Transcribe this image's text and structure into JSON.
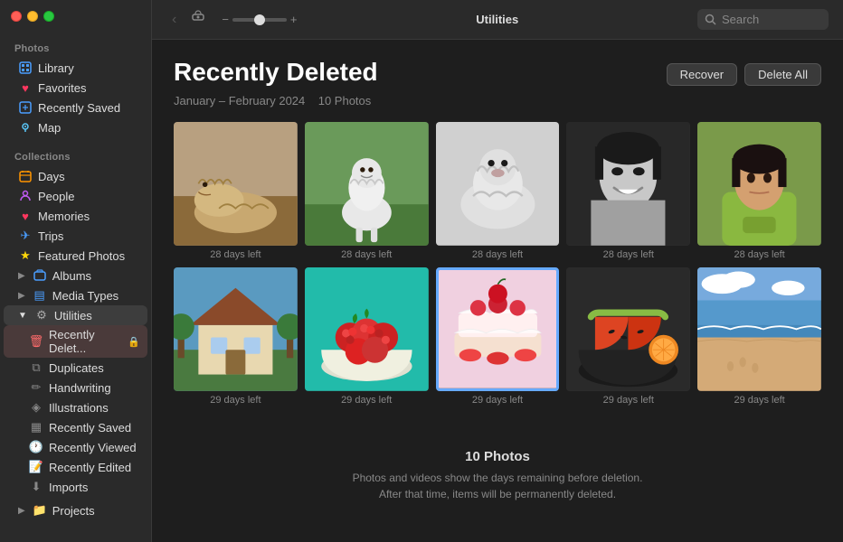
{
  "window": {
    "title": "Utilities"
  },
  "traffic_lights": {
    "red_label": "close",
    "yellow_label": "minimize",
    "green_label": "maximize"
  },
  "toolbar": {
    "back_label": "‹",
    "forward_label": "›",
    "zoom_minus": "−",
    "zoom_plus": "+",
    "title": "Utilities",
    "search_placeholder": "Search"
  },
  "sidebar": {
    "photos_section": "Photos",
    "collections_section": "Collections",
    "items": [
      {
        "id": "library",
        "label": "Library",
        "icon": "📷",
        "icon_color": "blue"
      },
      {
        "id": "favorites",
        "label": "Favorites",
        "icon": "♥",
        "icon_color": "pink"
      },
      {
        "id": "recently-saved",
        "label": "Recently Saved",
        "icon": "🕐",
        "icon_color": "blue"
      },
      {
        "id": "map",
        "label": "Map",
        "icon": "📍",
        "icon_color": "teal"
      }
    ],
    "collections": [
      {
        "id": "days",
        "label": "Days",
        "icon": "📅",
        "icon_color": "orange"
      },
      {
        "id": "people",
        "label": "People",
        "icon": "👤",
        "icon_color": "purple"
      },
      {
        "id": "memories",
        "label": "Memories",
        "icon": "♥",
        "icon_color": "pink"
      },
      {
        "id": "trips",
        "label": "Trips",
        "icon": "✈",
        "icon_color": "blue"
      },
      {
        "id": "featured-photos",
        "label": "Featured Photos",
        "icon": "★",
        "icon_color": "yellow"
      },
      {
        "id": "albums",
        "label": "Albums",
        "icon": "📁",
        "icon_color": "blue"
      },
      {
        "id": "media-types",
        "label": "Media Types",
        "icon": "▤",
        "icon_color": "blue"
      },
      {
        "id": "utilities",
        "label": "Utilities",
        "icon": "⚙",
        "icon_color": "gray",
        "expanded": true
      }
    ],
    "utilities_sub": [
      {
        "id": "recently-deleted",
        "label": "Recently Delet...",
        "icon": "🗑",
        "icon_color": "red",
        "active": true
      },
      {
        "id": "duplicates",
        "label": "Duplicates",
        "icon": "⧉",
        "icon_color": "gray"
      },
      {
        "id": "handwriting",
        "label": "Handwriting",
        "icon": "✏",
        "icon_color": "gray"
      },
      {
        "id": "illustrations",
        "label": "Illustrations",
        "icon": "🎨",
        "icon_color": "gray"
      },
      {
        "id": "recently-saved2",
        "label": "Recently Saved",
        "icon": "📋",
        "icon_color": "gray"
      },
      {
        "id": "recently-viewed",
        "label": "Recently Viewed",
        "icon": "🕐",
        "icon_color": "gray"
      },
      {
        "id": "recently-edited",
        "label": "Recently Edited",
        "icon": "📝",
        "icon_color": "gray"
      },
      {
        "id": "imports",
        "label": "Imports",
        "icon": "⬇",
        "icon_color": "gray"
      }
    ],
    "projects": {
      "label": "Projects",
      "icon": "📁",
      "icon_color": "blue"
    }
  },
  "content": {
    "title": "Recently Deleted",
    "date_range": "January – February 2024",
    "photo_count": "10 Photos",
    "recover_label": "Recover",
    "delete_all_label": "Delete All",
    "photos": [
      {
        "id": "p1",
        "days_left": "28 days left",
        "color1": "#8b7355",
        "color2": "#c9a87c"
      },
      {
        "id": "p2",
        "days_left": "28 days left",
        "color1": "#5a8a5a",
        "color2": "#7ab87a"
      },
      {
        "id": "p3",
        "days_left": "28 days left",
        "color1": "#c8c8c8",
        "color2": "#e0e0e0"
      },
      {
        "id": "p4",
        "days_left": "28 days left",
        "color1": "#1a1a1a",
        "color2": "#404040"
      },
      {
        "id": "p5",
        "days_left": "28 days left",
        "color1": "#6a8a3a",
        "color2": "#8ab05a"
      },
      {
        "id": "p6",
        "days_left": "29 days left",
        "color1": "#4a7a9a",
        "color2": "#6aaaca"
      },
      {
        "id": "p7",
        "days_left": "29 days left",
        "color1": "#cc3333",
        "color2": "#ee5555"
      },
      {
        "id": "p8",
        "days_left": "29 days left",
        "color1": "#dd4488",
        "color2": "#ff66aa"
      },
      {
        "id": "p9",
        "days_left": "29 days left",
        "color1": "#cc4422",
        "color2": "#ee7744"
      },
      {
        "id": "p10",
        "days_left": "29 days left",
        "color1": "#5599cc",
        "color2": "#77bbee"
      }
    ],
    "bottom_count": "10 Photos",
    "bottom_line1": "Photos and videos show the days remaining before deletion.",
    "bottom_line2": "After that time, items will be permanently deleted."
  }
}
